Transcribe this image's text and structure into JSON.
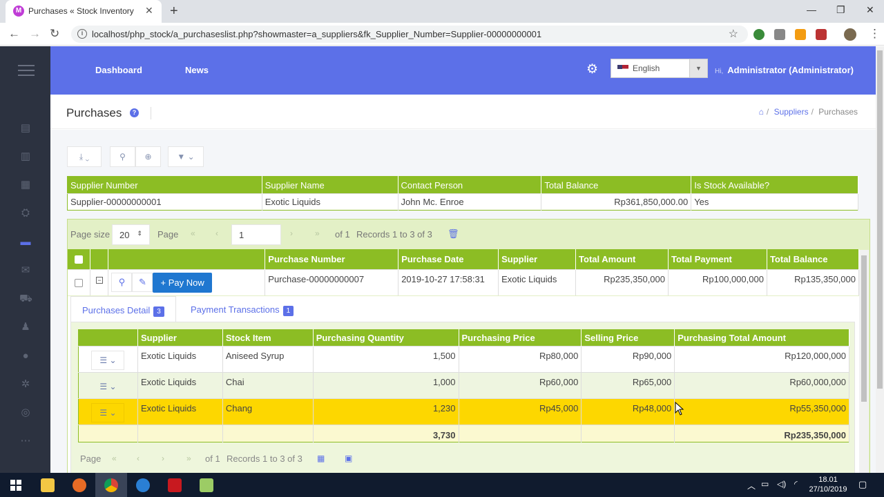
{
  "browser": {
    "tab_title": "Purchases « Stock Inventory",
    "favicon_letter": "M",
    "url": "localhost/php_stock/a_purchaseslist.php?showmaster=a_suppliers&fk_Supplier_Number=Supplier-00000000001"
  },
  "header": {
    "nav": [
      "Dashboard",
      "News"
    ],
    "language": "English",
    "hi": "Hi,",
    "user": "Administrator (Administrator)"
  },
  "page": {
    "title": "Purchases",
    "breadcrumb": [
      "Suppliers",
      "Purchases"
    ]
  },
  "master": {
    "columns": [
      "Supplier Number",
      "Supplier Name",
      "Contact Person",
      "Total Balance",
      "Is Stock Available?"
    ],
    "row": [
      "Supplier-00000000001",
      "Exotic Liquids",
      "John Mc. Enroe",
      "Rp361,850,000.00",
      "Yes"
    ]
  },
  "pager": {
    "page_size_label": "Page size",
    "page_size": "20",
    "page_label": "Page",
    "page": "1",
    "of": "of 1",
    "records": "Records 1 to 3 of 3"
  },
  "purchases": {
    "columns": [
      "Purchase Number",
      "Purchase Date",
      "Supplier",
      "Total Amount",
      "Total Payment",
      "Total Balance"
    ],
    "pay_now": "Pay Now",
    "row": [
      "Purchase-00000000007",
      "2019-10-27 17:58:31",
      "Exotic Liquids",
      "Rp235,350,000",
      "Rp100,000,000",
      "Rp135,350,000"
    ]
  },
  "detail_tabs": [
    {
      "label": "Purchases Detail",
      "count": "3"
    },
    {
      "label": "Payment Transactions",
      "count": "1"
    }
  ],
  "detail": {
    "columns": [
      "Supplier",
      "Stock Item",
      "Purchasing Quantity",
      "Purchasing Price",
      "Selling Price",
      "Purchasing Total Amount"
    ],
    "rows": [
      [
        "Exotic Liquids",
        "Aniseed Syrup",
        "1,500",
        "Rp80,000",
        "Rp90,000",
        "Rp120,000,000"
      ],
      [
        "Exotic Liquids",
        "Chai",
        "1,000",
        "Rp60,000",
        "Rp65,000",
        "Rp60,000,000"
      ],
      [
        "Exotic Liquids",
        "Chang",
        "1,230",
        "Rp45,000",
        "Rp48,000",
        "Rp55,350,000"
      ]
    ],
    "total_quantity": "3,730",
    "total_amount": "Rp235,350,000",
    "pager_page": "Page",
    "pager_of": "of 1",
    "pager_records": "Records 1 to 3 of 3"
  },
  "taskbar": {
    "time": "18.01",
    "date": "27/10/2019"
  },
  "colors": {
    "accent": "#5c70e8",
    "grid_header": "#8cbd24",
    "selected_row": "#fdd700",
    "sidebar": "#2c3240",
    "pay_button": "#1f77d0"
  },
  "icons": [
    "home-icon",
    "help-icon",
    "gear-icon",
    "search-icon",
    "filter-icon",
    "export-icon",
    "trash-icon",
    "view-icon",
    "edit-icon",
    "plus-icon",
    "menu-icon"
  ]
}
